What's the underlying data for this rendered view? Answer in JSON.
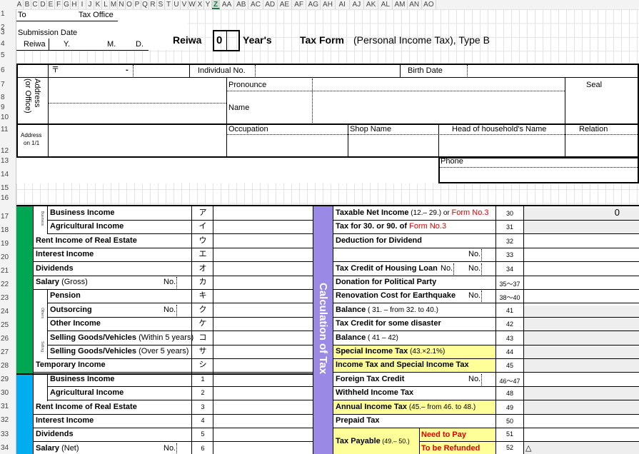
{
  "columns": [
    "A",
    "B",
    "C",
    "D",
    "E",
    "F",
    "G",
    "H",
    "I",
    "J",
    "K",
    "L",
    "M",
    "N",
    "O",
    "P",
    "Q",
    "R",
    "S",
    "T",
    "U",
    "V",
    "W",
    "X",
    "Y",
    "Z",
    "AA",
    "AB",
    "AC",
    "AD",
    "AE",
    "AF",
    "AG",
    "AH",
    "AI",
    "AJ",
    "AK",
    "AL",
    "AM",
    "AN",
    "AO"
  ],
  "selected_column": "Z",
  "rows": [
    "1",
    "2",
    "3",
    "4",
    "5",
    "6",
    "7",
    "8",
    "9",
    "10",
    "11",
    "12",
    "13",
    "14",
    "15",
    "16",
    "17",
    "18",
    "19",
    "20",
    "21",
    "22",
    "23",
    "24",
    "25",
    "26",
    "27",
    "28",
    "29",
    "30",
    "31",
    "32",
    "33",
    "34"
  ],
  "header": {
    "to": "To",
    "tax_office": "Tax Office",
    "submission_date": "Submission Date",
    "reiwa_small": "Reiwa",
    "y": "Y.",
    "m": "M.",
    "d": "D.",
    "reiwa": "Reiwa",
    "year_value": "0",
    "years": "Year's",
    "tax_form": "Tax  Form",
    "form_desc": "(Personal Income Tax), Type B"
  },
  "personal": {
    "postal_mark": "〒",
    "dash": "-",
    "individual_no": "Individual No.",
    "birth_date": "Birth Date",
    "address": "Address",
    "or_office": "(or Office)",
    "pronounce": "Pronounce",
    "seal": "Seal",
    "name": "Name",
    "address_on": "Address",
    "on_date": "on 1/1",
    "occupation": "Occupation",
    "shop_name": "Shop Name",
    "head_household": "Head of household's Name",
    "relation": "Relation",
    "phone": "Phone"
  },
  "left": {
    "income_types": {
      "business": "Business",
      "others": "Others",
      "selling": "Selling"
    },
    "income_rows": [
      {
        "label": "Business Income",
        "code": "ア"
      },
      {
        "label": "Agricultural Income",
        "code": "イ"
      },
      {
        "label": "Rent Income of Real Estate",
        "code": "ウ"
      },
      {
        "label": "Interest Income",
        "code": "エ"
      },
      {
        "label": "Dividends",
        "code": "オ"
      },
      {
        "label": "Salary",
        "suffix": " (Gross)",
        "no": "No.",
        "code": "カ"
      },
      {
        "label": "Pension",
        "code": "キ"
      },
      {
        "label": "Outsorcing",
        "no": "No.",
        "code": "ク"
      },
      {
        "label": "Other Income",
        "code": "ケ"
      },
      {
        "label": "Selling Goods/Vehicles",
        "suffix": " (Within 5 years)",
        "code": "コ"
      },
      {
        "label": "Selling Goods/Vehicles",
        "suffix": " (Over 5 years)",
        "code": "サ"
      },
      {
        "label": "Temporary Income",
        "code": "シ"
      }
    ],
    "amount_rows": [
      {
        "label": "Business Income",
        "code": "1"
      },
      {
        "label": "Agricultural Income",
        "code": "2"
      },
      {
        "label": "Rent Income of Real Estate",
        "code": "3"
      },
      {
        "label": "Interest Income",
        "code": "4"
      },
      {
        "label": "Dividends",
        "code": "5"
      },
      {
        "label": "Salary",
        "suffix": " (Net)",
        "no": "No.",
        "code": "6"
      }
    ]
  },
  "middle": {
    "calc_title": "Calculation of Tax"
  },
  "right": {
    "rows": [
      {
        "label": "Taxable Net Income",
        "extra": " (12.– 29.) or ",
        "red": "Form No.3",
        "code": "30",
        "value": "0"
      },
      {
        "label": "Tax for 30. or 90. of ",
        "red": "Form No.3",
        "code": "31"
      },
      {
        "label": "Deduction for Dividend",
        "code": "32"
      },
      {
        "label": "",
        "no": "No.",
        "code": "33"
      },
      {
        "label": "Tax Credit of Housing Loan",
        "no": "No.",
        "no2": "No.",
        "code": "34"
      },
      {
        "label": "Donation for Political Party",
        "code": "35～37"
      },
      {
        "label": "Renovation Cost for Earthquake",
        "no": "No.",
        "code": "38～40"
      },
      {
        "label": "Balance",
        "extra": " ( 31. –   from 32. to 40.)",
        "code": "41"
      },
      {
        "label": "Tax Credit for some disaster",
        "code": "42"
      },
      {
        "label": "Balance",
        "extra": " ( 41 – 42)",
        "code": "43"
      },
      {
        "label": "Special Income Tax",
        "extra": " (43.×2.1%)",
        "code": "44",
        "yellow": true
      },
      {
        "label": "Income Tax and Special Income Tax",
        "code": "45",
        "yellow": true
      },
      {
        "label": "Foreign Tax Credit",
        "no": "No.",
        "code": "46～47"
      },
      {
        "label": "Withheld Income Tax",
        "code": "48"
      },
      {
        "label": "Annual Income Tax",
        "extra": " (45.– from 46. to 48.)",
        "code": "49",
        "yellow": true
      },
      {
        "label": "Prepaid Tax",
        "code": "50"
      }
    ],
    "payable": {
      "label": "Tax Payable",
      "extra": " (49.– 50.)",
      "need": "Need to Pay",
      "refund": "To be Refunded",
      "code1": "51",
      "code2": "52",
      "triangle": "△"
    }
  }
}
